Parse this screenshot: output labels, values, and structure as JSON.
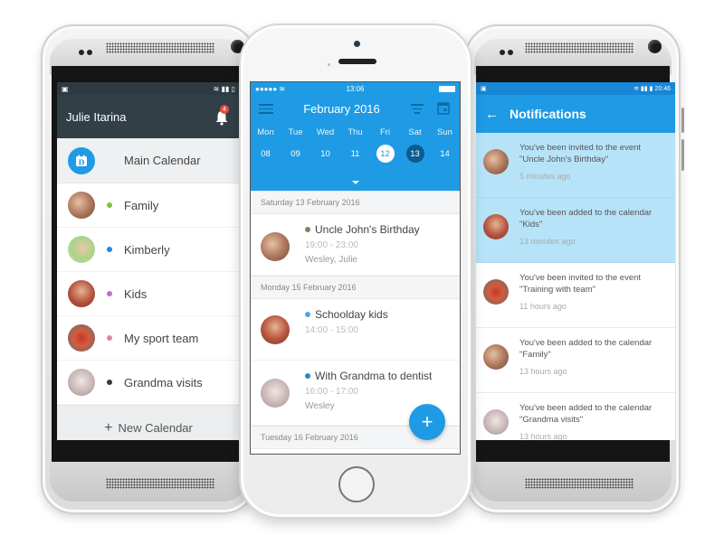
{
  "left_phone": {
    "header": {
      "user_name": "Julie Itarina",
      "notification_count": "4"
    },
    "main_calendar": {
      "label": "Main Calendar",
      "icon_letter": "D"
    },
    "calendars": [
      {
        "label": "Family",
        "dot_color": "#7dc242",
        "avatar": "family"
      },
      {
        "label": "Kimberly",
        "dot_color": "#1e88e5",
        "avatar": "kimberly"
      },
      {
        "label": "Kids",
        "dot_color": "#c36bd1",
        "avatar": "kids"
      },
      {
        "label": "My sport team",
        "dot_color": "#d98c95",
        "avatar": "sport"
      },
      {
        "label": "Grandma visits",
        "dot_color": "#2f3e3a",
        "avatar": "grandma"
      }
    ],
    "new_calendar_label": "New Calendar"
  },
  "center_phone": {
    "status_time": "13:06",
    "month_title": "February 2016",
    "weekdays": [
      "Mon",
      "Tue",
      "Wed",
      "Thu",
      "Fri",
      "Sat",
      "Sun"
    ],
    "days": [
      "08",
      "09",
      "10",
      "11",
      "12",
      "13",
      "14"
    ],
    "today_day": "12",
    "selected_day": "13",
    "sections": [
      {
        "date": "Saturday 13 February 2016",
        "events": [
          {
            "title": "Uncle John's Birthday",
            "time": "19:00 - 23:00",
            "people": "Wesley, Julie",
            "dot_color": "#8a7d5c",
            "avatar": "family"
          }
        ]
      },
      {
        "date": "Monday 15 February 2016",
        "events": [
          {
            "title": "Schoolday kids",
            "time": "14:00 - 15:00",
            "people": "",
            "dot_color": "#4aa8d8",
            "avatar": "kids"
          },
          {
            "title": "With Grandma to dentist",
            "time": "16:00 - 17:00",
            "people": "Wesley",
            "dot_color": "#1b8fc4",
            "avatar": "grandma"
          }
        ]
      },
      {
        "date": "Tuesday 16 February 2016",
        "events": []
      }
    ],
    "fab_label": "+"
  },
  "right_phone": {
    "status_time": "20:46",
    "title": "Notifications",
    "notifications": [
      {
        "message": "You've been invited to the event \"Uncle John's Birthday\"",
        "time": "5 minutes ago",
        "unread": true,
        "avatar": "family"
      },
      {
        "message": "You've been added to the calendar \"Kids\"",
        "time": "13 minutes ago",
        "unread": true,
        "avatar": "kids"
      },
      {
        "message": "You've been invited to the event \"Training with team\"",
        "time": "11 hours ago",
        "unread": false,
        "avatar": "sport"
      },
      {
        "message": "You've been added to the calendar \"Family\"",
        "time": "13 hours ago",
        "unread": false,
        "avatar": "family"
      },
      {
        "message": "You've been added to the calendar \"Grandma visits\"",
        "time": "13 hours ago",
        "unread": false,
        "avatar": "grandma"
      }
    ]
  },
  "colors": {
    "primary_blue": "#1e9be4",
    "dark_header": "#313f47",
    "unread_bg": "#b7e3f8",
    "selected_day": "#0d5c8f",
    "badge_red": "#e74c3c"
  }
}
